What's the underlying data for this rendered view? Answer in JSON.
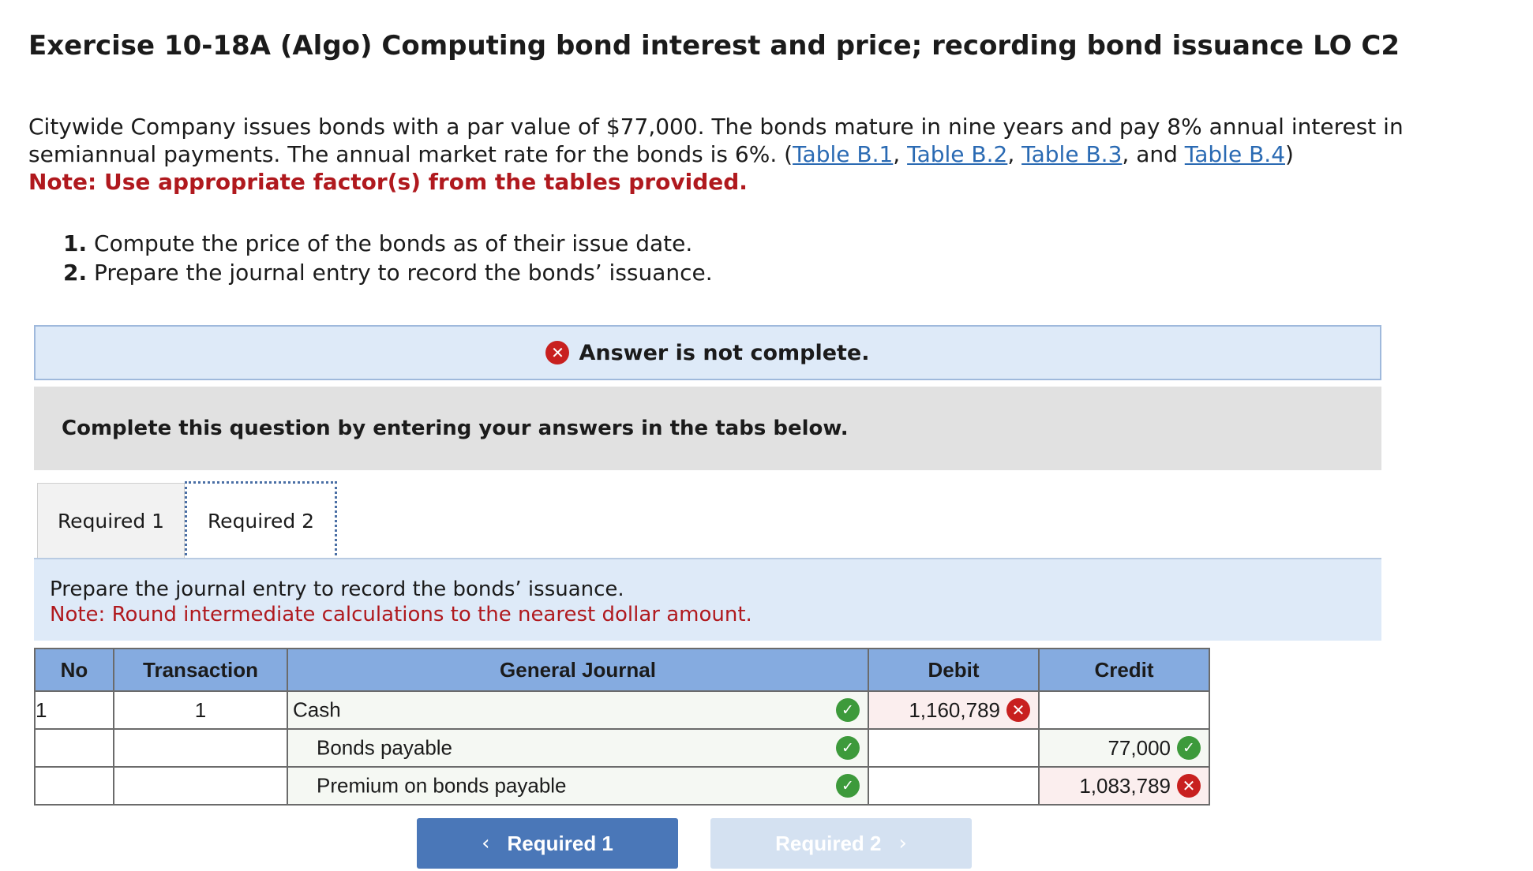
{
  "exercise": {
    "title": "Exercise 10-18A (Algo) Computing bond interest and price; recording bond issuance LO C2",
    "problem_text_1": "Citywide Company issues bonds with a par value of $77,000. The bonds mature in nine years and pay 8% annual interest in semiannual payments. The annual market rate for the bonds is 6%. (",
    "table_links": [
      "Table B.1",
      "Table B.2",
      "Table B.3",
      "Table B.4"
    ],
    "sep_comma": ", ",
    "sep_and": ", and ",
    "close_paren": ")",
    "note": "Note: Use appropriate factor(s) from the tables provided.",
    "requirements": [
      {
        "num": "1.",
        "text": " Compute the price of the bonds as of their issue date."
      },
      {
        "num": "2.",
        "text": " Prepare the journal entry to record the bonds’ issuance."
      }
    ]
  },
  "status_banner": {
    "icon": "x-circle-icon",
    "symbol": "✕",
    "text": "Answer is not complete."
  },
  "instructions_box": "Complete this question by entering your answers in the tabs below.",
  "tabs": [
    {
      "label": "Required 1",
      "active": false
    },
    {
      "label": "Required 2",
      "active": true
    }
  ],
  "tab_panel": {
    "instruction": "Prepare the journal entry to record the bonds’ issuance.",
    "note": "Note: Round intermediate calculations to the nearest dollar amount."
  },
  "journal": {
    "headers": [
      "No",
      "Transaction",
      "General Journal",
      "Debit",
      "Credit"
    ],
    "rows": [
      {
        "no": "1",
        "transaction": "1",
        "account": "Cash",
        "account_status": "correct",
        "debit": "1,160,789",
        "debit_status": "incorrect",
        "credit": "",
        "credit_status": ""
      },
      {
        "no": "",
        "transaction": "",
        "account": "Bonds payable",
        "account_status": "correct",
        "debit": "",
        "debit_status": "",
        "credit": "77,000",
        "credit_status": "correct"
      },
      {
        "no": "",
        "transaction": "",
        "account": "Premium on bonds payable",
        "account_status": "correct",
        "debit": "",
        "debit_status": "",
        "credit": "1,083,789",
        "credit_status": "incorrect"
      }
    ],
    "check_symbol": "✓",
    "x_symbol": "✕"
  },
  "navigation": {
    "prev_label": "Required 1",
    "prev_chevron": "‹",
    "next_label": "Required 2",
    "next_chevron": "›"
  },
  "colors": {
    "link": "#2a6ab3",
    "note_red": "#b0191e",
    "header_blue": "#85abe0",
    "correct_green": "#3d9a3b",
    "incorrect_red": "#c8201f",
    "nav_active": "#4a77b8",
    "nav_disabled": "#d4e1f1"
  }
}
